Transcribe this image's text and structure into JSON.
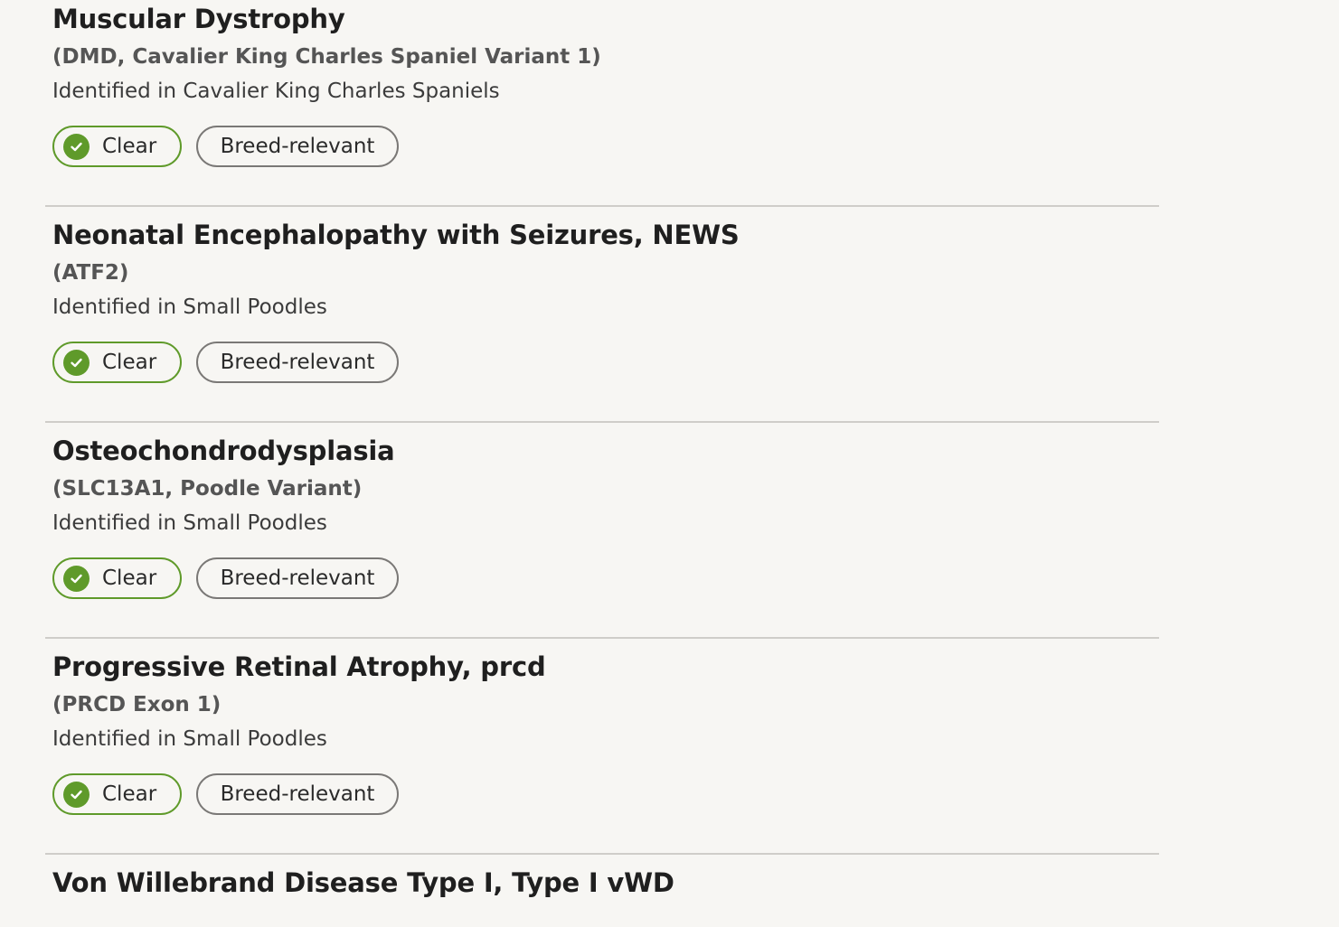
{
  "colors": {
    "background": "#f7f6f3",
    "clear_green": "#5f9a2a",
    "divider": "#cfcdc9"
  },
  "conditions": [
    {
      "title": "Muscular Dystrophy",
      "gene": "(DMD, Cavalier King Charles Spaniel Variant 1)",
      "identified": "Identified in Cavalier King Charles Spaniels",
      "status": "Clear",
      "status_icon": "check-circle-icon",
      "tag": "Breed-relevant"
    },
    {
      "title": "Neonatal Encephalopathy with Seizures, NEWS",
      "gene": "(ATF2)",
      "identified": "Identified in Small Poodles",
      "status": "Clear",
      "status_icon": "check-circle-icon",
      "tag": "Breed-relevant"
    },
    {
      "title": "Osteochondrodysplasia",
      "gene": "(SLC13A1, Poodle Variant)",
      "identified": "Identified in Small Poodles",
      "status": "Clear",
      "status_icon": "check-circle-icon",
      "tag": "Breed-relevant"
    },
    {
      "title": "Progressive Retinal Atrophy, prcd",
      "gene": "(PRCD Exon 1)",
      "identified": "Identified in Small Poodles",
      "status": "Clear",
      "status_icon": "check-circle-icon",
      "tag": "Breed-relevant"
    },
    {
      "title": "Von Willebrand Disease Type I, Type I vWD"
    }
  ]
}
